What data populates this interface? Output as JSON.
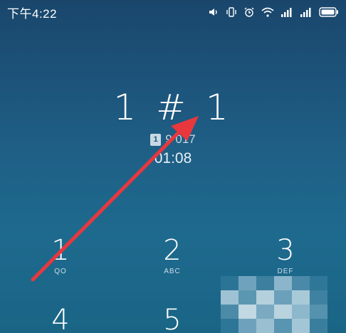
{
  "status_bar": {
    "time": "下午4:22",
    "icons": [
      "volume-icon",
      "vibrate-icon",
      "alarm-icon",
      "wifi-icon",
      "signal-icon",
      "signal-icon",
      "battery-icon"
    ]
  },
  "call": {
    "dialed_number": "1 # 1",
    "sim_label": "1",
    "sim_number_partial": "9 017",
    "duration": "01:08"
  },
  "keypad": {
    "keys": [
      {
        "digit": "1",
        "letters": "QO"
      },
      {
        "digit": "2",
        "letters": "ABC"
      },
      {
        "digit": "3",
        "letters": "DEF"
      },
      {
        "digit": "4",
        "letters": ""
      },
      {
        "digit": "5",
        "letters": ""
      }
    ]
  },
  "colors": {
    "background_top": "#1a466c",
    "background_bottom": "#1e6a8e",
    "arrow": "#e8383d"
  }
}
